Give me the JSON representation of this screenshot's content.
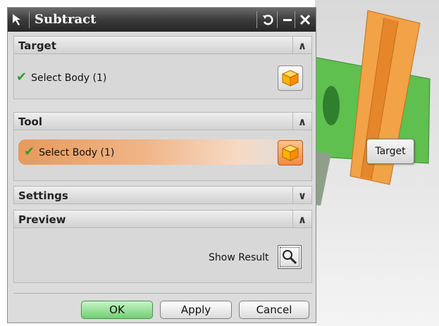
{
  "dialog": {
    "title": "Subtract",
    "controls": {
      "reset_icon": "undo-icon",
      "minimize_icon": "minimize-icon",
      "close_icon": "close-icon"
    }
  },
  "sections": {
    "target": {
      "header": "Target",
      "collapse_icon": "chevron-up-icon",
      "select_label": "Select Body (1)",
      "status_icon": "checkmark-icon"
    },
    "tool": {
      "header": "Tool",
      "collapse_icon": "chevron-up-icon",
      "select_label": "Select Body (1)",
      "status_icon": "checkmark-icon"
    },
    "settings": {
      "header": "Settings",
      "collapse_icon": "chevron-down-icon"
    },
    "preview": {
      "header": "Preview",
      "collapse_icon": "chevron-up-icon",
      "show_result_label": "Show Result"
    }
  },
  "footer": {
    "ok_label": "OK",
    "apply_label": "Apply",
    "cancel_label": "Cancel"
  },
  "viewport": {
    "tag_label": "Target"
  },
  "colors": {
    "titlebar": "#3b3b3b",
    "active_selection": "#e69a5d",
    "ok_button": "#72cf72",
    "target_body": "#5cb85c",
    "tool_body": "#f0a040"
  }
}
